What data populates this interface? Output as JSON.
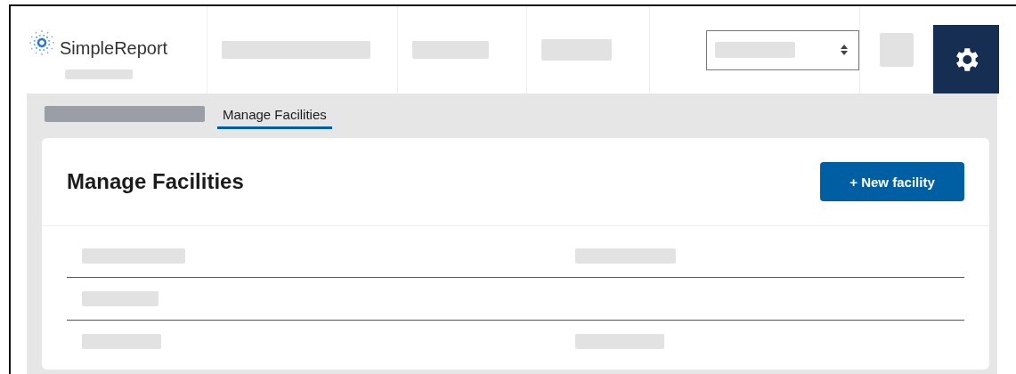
{
  "header": {
    "logo": "SimpleReport"
  },
  "breadcrumb": [
    {
      "label": "Manage Facilities",
      "selected": true
    }
  ],
  "page": {
    "title": "Manage Facilities",
    "new_button": "+ New facility"
  }
}
